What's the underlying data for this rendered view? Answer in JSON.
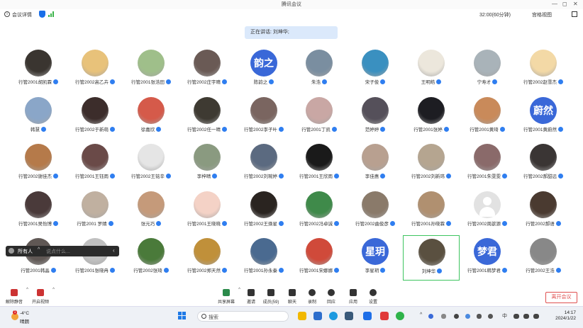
{
  "window": {
    "title": "腾讯会议",
    "min": "—",
    "max": "◻",
    "close": "✕"
  },
  "header": {
    "info_label": "会议详情",
    "timer": "32:00(60分钟)",
    "view": "宫格视图"
  },
  "speaking": "正在讲话: 刘坤华;",
  "participants": [
    {
      "name": "行管2001胡凯霖",
      "kind": "photo",
      "color": "#3a3530"
    },
    {
      "name": "行管2002高乙卉",
      "kind": "photo",
      "color": "#e8c27a"
    },
    {
      "name": "行管2001张浩田",
      "kind": "photo",
      "color": "#9fbf8a"
    },
    {
      "name": "行管2002庄宇晴",
      "kind": "photo",
      "color": "#6a5a55"
    },
    {
      "name": "陈韵之",
      "kind": "text",
      "initials": "韵之",
      "color": "#3a68d8"
    },
    {
      "name": "朱浩",
      "kind": "photo",
      "color": "#7a8ea0"
    },
    {
      "name": "宋子俊",
      "kind": "photo",
      "color": "#3a90c0"
    },
    {
      "name": "王明皓",
      "kind": "photo",
      "color": "#ece7dc"
    },
    {
      "name": "宁寿才",
      "kind": "photo",
      "color": "#a9b3b9"
    },
    {
      "name": "行管2002赵雪杰",
      "kind": "photo",
      "color": "#f3d9a6"
    },
    {
      "name": "韩慧",
      "kind": "photo",
      "color": "#8aa6c8"
    },
    {
      "name": "行管2002于新萌",
      "kind": "photo",
      "color": "#3c2d2b"
    },
    {
      "name": "徐嘉欣",
      "kind": "photo",
      "color": "#d55a4a"
    },
    {
      "name": "行管2002任一晴",
      "kind": "photo",
      "color": "#3e3a32"
    },
    {
      "name": "行管2002李子叶",
      "kind": "photo",
      "color": "#7a6560"
    },
    {
      "name": "行管2001丁凯",
      "kind": "photo",
      "color": "#c9a7a4"
    },
    {
      "name": "范婷婷",
      "kind": "photo",
      "color": "#55505a"
    },
    {
      "name": "行管2001张婷",
      "kind": "photo",
      "color": "#1d1d22"
    },
    {
      "name": "行管2001黄琦",
      "kind": "photo",
      "color": "#c98a5a"
    },
    {
      "name": "行管2001黄蔚然",
      "kind": "text",
      "initials": "蔚然",
      "color": "#3a68d8"
    },
    {
      "name": "行管2002谢佳杰",
      "kind": "photo",
      "color": "#b57a4a"
    },
    {
      "name": "行管2001王钰雨",
      "kind": "photo",
      "color": "#6a4a48"
    },
    {
      "name": "行管2002王铭辛",
      "kind": "photo",
      "color": "#e5e5e5"
    },
    {
      "name": "李梓晴",
      "kind": "photo",
      "color": "#8a9a80"
    },
    {
      "name": "行管2002刘琬婷",
      "kind": "photo",
      "color": "#5b6a80"
    },
    {
      "name": "行管2001王欣雨",
      "kind": "photo",
      "color": "#1a1a1a"
    },
    {
      "name": "李佳惠",
      "kind": "photo",
      "color": "#b8a090"
    },
    {
      "name": "行管2002刘新玮",
      "kind": "photo",
      "color": "#b5a590"
    },
    {
      "name": "行管2001朱雯雯",
      "kind": "photo",
      "color": "#8a6a6a"
    },
    {
      "name": "行管2002郝甜远",
      "kind": "photo",
      "color": "#3a3534"
    },
    {
      "name": "行管2001吴怡博",
      "kind": "photo",
      "color": "#4a3a3a"
    },
    {
      "name": "行管2001 罗婧",
      "kind": "photo",
      "color": "#c0b0a0"
    },
    {
      "name": "张元巧",
      "kind": "photo",
      "color": "#c59a7a"
    },
    {
      "name": "行管2001王晓晓",
      "kind": "photo",
      "color": "#f4d2c6"
    },
    {
      "name": "行管2002王焕星",
      "kind": "photo",
      "color": "#2a2420"
    },
    {
      "name": "行管2002冯卓诚",
      "kind": "photo",
      "color": "#3f8a4a"
    },
    {
      "name": "行管2002曲俊彦",
      "kind": "photo",
      "color": "#8a7a6a"
    },
    {
      "name": "行管2001孙晓霖",
      "kind": "photo",
      "color": "#b09070"
    },
    {
      "name": "行管2002周歆源",
      "kind": "blank",
      "color": "#e2e2e2"
    },
    {
      "name": "行管2002郝语",
      "kind": "photo",
      "color": "#4a3a30"
    },
    {
      "name": "行管2001韩晶",
      "kind": "photo",
      "color": "#605855"
    },
    {
      "name": "行管2001张晓冉",
      "kind": "photo",
      "color": "#c0c0c0"
    },
    {
      "name": "行管2002张琦",
      "kind": "photo",
      "color": "#4a7a3a"
    },
    {
      "name": "行管2002郑天然",
      "kind": "photo",
      "color": "#c0903a"
    },
    {
      "name": "行管2001孙永秦",
      "kind": "photo",
      "color": "#4a6a90"
    },
    {
      "name": "行管2001宋娜娜",
      "kind": "photo",
      "color": "#d04a3a"
    },
    {
      "name": "李星玥",
      "kind": "text",
      "initials": "星玥",
      "color": "#3a68d8"
    },
    {
      "name": "刘坤华",
      "kind": "photo",
      "color": "#5a5040",
      "active": true
    },
    {
      "name": "行管2001韩梦君",
      "kind": "text",
      "initials": "梦君",
      "color": "#3a68d8"
    },
    {
      "name": "行管2002王浩",
      "kind": "photo",
      "color": "#888888"
    }
  ],
  "chat": {
    "who": "所有人",
    "caret": "^",
    "placeholder": "说点什么...",
    "collapse": "‹"
  },
  "toolbar": {
    "left": [
      {
        "label": "解除静音",
        "up": "^"
      },
      {
        "label": "开启视频",
        "up": "^"
      }
    ],
    "center": [
      {
        "label": "共享屏幕",
        "up": "^"
      },
      {
        "label": "邀请"
      },
      {
        "label": "成员(59)"
      },
      {
        "label": "聊天"
      },
      {
        "label": "录制"
      },
      {
        "label": "回应"
      },
      {
        "label": "应用"
      },
      {
        "label": "设置"
      }
    ],
    "leave": "离开会议"
  },
  "taskbar": {
    "weather_badge": "1",
    "temp": "-4°C",
    "condition": "晴朗",
    "search_placeholder": "搜索",
    "ime": "中",
    "time": "14:17",
    "date": "2024/1/22"
  }
}
